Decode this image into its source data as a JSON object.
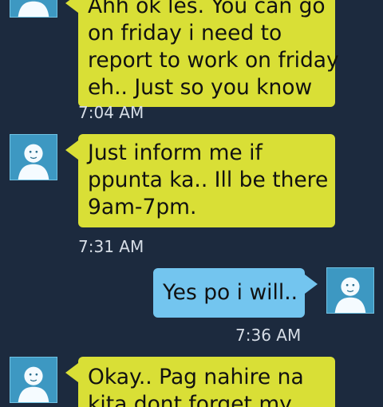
{
  "messages": [
    {
      "direction": "incoming",
      "lines": [
        "Ahh ok les. You can go",
        "on friday i need to",
        "report to work on friday",
        "eh.. Just so you know"
      ],
      "time": "7:04 AM"
    },
    {
      "direction": "incoming",
      "lines": [
        "Just inform me if",
        "ppunta ka.. Ill be there",
        "9am-7pm."
      ],
      "time": "7:31 AM"
    },
    {
      "direction": "outgoing",
      "lines": [
        "Yes po i will.."
      ],
      "time": "7:36 AM"
    },
    {
      "direction": "incoming",
      "lines": [
        "Okay.. Pag nahire na",
        "kita dont forget my"
      ],
      "time": ""
    }
  ],
  "icons": {
    "contact_avatar": "default-person-avatar-icon"
  },
  "colors": {
    "background": "#1c2a3e",
    "incoming_bubble": "#d9df36",
    "outgoing_bubble": "#73c5ef",
    "avatar_bg": "#3d98c2",
    "timestamp": "#d6dde6"
  }
}
